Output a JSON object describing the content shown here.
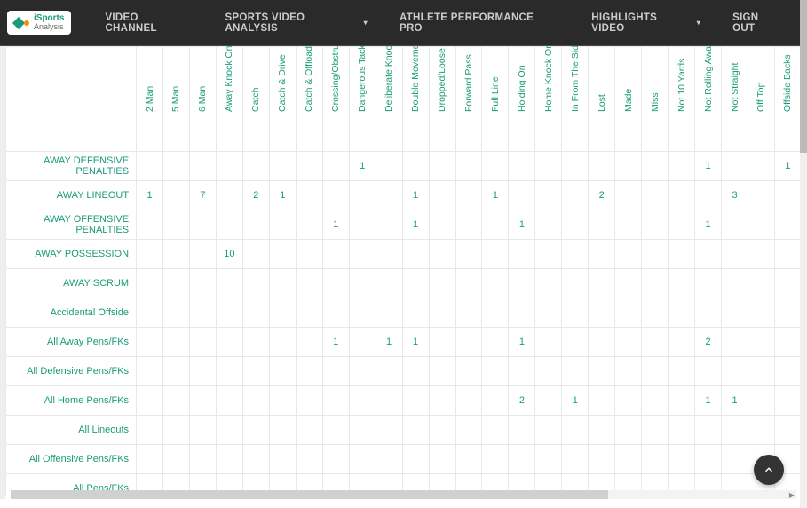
{
  "nav": {
    "items": [
      {
        "label": "VIDEO CHANNEL",
        "dropdown": false
      },
      {
        "label": "SPORTS VIDEO ANALYSIS",
        "dropdown": true
      },
      {
        "label": "ATHLETE PERFORMANCE PRO",
        "dropdown": false
      },
      {
        "label": "HIGHLIGHTS VIDEO",
        "dropdown": true
      },
      {
        "label": "SIGN OUT",
        "dropdown": false
      }
    ]
  },
  "logo": {
    "line1a": "iSports",
    "line2": "Analysis"
  },
  "columns": [
    "2 Man",
    "5 Man",
    "6 Man",
    "Away Knock On",
    "Catch",
    "Catch & Drive",
    "Catch & Offload",
    "Crossing/Obstruction",
    "Dangerous Tackle",
    "Deliberate Knock On",
    "Double Movement",
    "Dropped/Loose",
    "Forward Pass",
    "Full Line",
    "Holding On",
    "Home Knock On",
    "In From The Side",
    "Lost",
    "Made",
    "Miss",
    "Not 10 Yards",
    "Not Rolling Away",
    "Not Straight",
    "Off Top",
    "Offside Backs"
  ],
  "rows": [
    {
      "label": "AWAY DEFENSIVE PENALTIES",
      "cells": [
        "",
        "",
        "",
        "",
        "",
        "",
        "",
        "",
        "1",
        "",
        "",
        "",
        "",
        "",
        "",
        "",
        "",
        "",
        "",
        "",
        "",
        "1",
        "",
        "",
        "1"
      ]
    },
    {
      "label": "AWAY LINEOUT",
      "cells": [
        "1",
        "",
        "7",
        "",
        "2",
        "1",
        "",
        "",
        "",
        "",
        "1",
        "",
        "",
        "1",
        "",
        "",
        "",
        "2",
        "",
        "",
        "",
        "",
        "3",
        "",
        ""
      ]
    },
    {
      "label": "AWAY OFFENSIVE PENALTIES",
      "cells": [
        "",
        "",
        "",
        "",
        "",
        "",
        "",
        "1",
        "",
        "",
        "1",
        "",
        "",
        "",
        "1",
        "",
        "",
        "",
        "",
        "",
        "",
        "1",
        "",
        "",
        ""
      ]
    },
    {
      "label": "AWAY POSSESSION",
      "cells": [
        "",
        "",
        "",
        "10",
        "",
        "",
        "",
        "",
        "",
        "",
        "",
        "",
        "",
        "",
        "",
        "",
        "",
        "",
        "",
        "",
        "",
        "",
        "",
        "",
        ""
      ]
    },
    {
      "label": "AWAY SCRUM",
      "cells": [
        "",
        "",
        "",
        "",
        "",
        "",
        "",
        "",
        "",
        "",
        "",
        "",
        "",
        "",
        "",
        "",
        "",
        "",
        "",
        "",
        "",
        "",
        "",
        "",
        ""
      ]
    },
    {
      "label": "Accidental Offside",
      "cells": [
        "",
        "",
        "",
        "",
        "",
        "",
        "",
        "",
        "",
        "",
        "",
        "",
        "",
        "",
        "",
        "",
        "",
        "",
        "",
        "",
        "",
        "",
        "",
        "",
        ""
      ]
    },
    {
      "label": "All Away Pens/FKs",
      "cells": [
        "",
        "",
        "",
        "",
        "",
        "",
        "",
        "1",
        "",
        "1",
        "1",
        "",
        "",
        "",
        "1",
        "",
        "",
        "",
        "",
        "",
        "",
        "2",
        "",
        "",
        ""
      ]
    },
    {
      "label": "All Defensive Pens/FKs",
      "cells": [
        "",
        "",
        "",
        "",
        "",
        "",
        "",
        "",
        "",
        "",
        "",
        "",
        "",
        "",
        "",
        "",
        "",
        "",
        "",
        "",
        "",
        "",
        "",
        "",
        ""
      ]
    },
    {
      "label": "All Home Pens/FKs",
      "cells": [
        "",
        "",
        "",
        "",
        "",
        "",
        "",
        "",
        "",
        "",
        "",
        "",
        "",
        "",
        "2",
        "",
        "1",
        "",
        "",
        "",
        "",
        "1",
        "1",
        "",
        ""
      ]
    },
    {
      "label": "All Lineouts",
      "cells": [
        "",
        "",
        "",
        "",
        "",
        "",
        "",
        "",
        "",
        "",
        "",
        "",
        "",
        "",
        "",
        "",
        "",
        "",
        "",
        "",
        "",
        "",
        "",
        "",
        ""
      ]
    },
    {
      "label": "All Offensive Pens/FKs",
      "cells": [
        "",
        "",
        "",
        "",
        "",
        "",
        "",
        "",
        "",
        "",
        "",
        "",
        "",
        "",
        "",
        "",
        "",
        "",
        "",
        "",
        "",
        "",
        "",
        "",
        ""
      ]
    },
    {
      "label": "All Pens/FKs",
      "cells": [
        "",
        "",
        "",
        "",
        "",
        "",
        "",
        "",
        "",
        "",
        "",
        "",
        "",
        "",
        "",
        "",
        "",
        "",
        "",
        "",
        "",
        "",
        "",
        "",
        ""
      ]
    }
  ]
}
